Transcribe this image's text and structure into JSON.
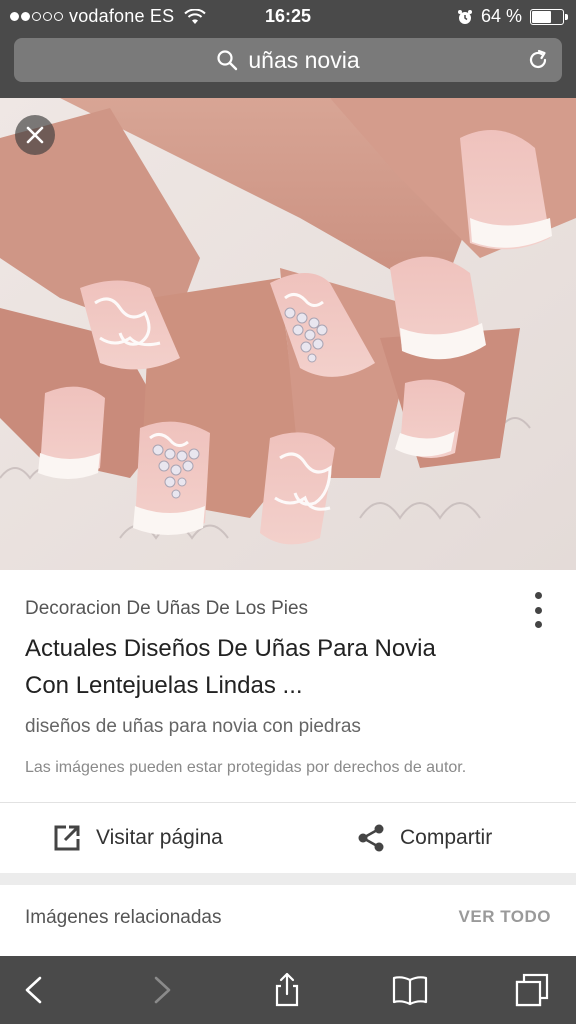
{
  "status_bar": {
    "carrier": "vodafone ES",
    "time": "16:25",
    "battery": "64 %",
    "battery_level": 0.64
  },
  "search": {
    "query": "uñas novia"
  },
  "result": {
    "source": "Decoracion De Uñas De Los Pies",
    "title_line1": "Actuales Diseños De Uñas Para Novia",
    "title_line2": "Con Lentejuelas Lindas ...",
    "description": "diseños de uñas para novia con piedras",
    "copyright": "Las imágenes pueden estar protegidas por derechos de autor."
  },
  "actions": {
    "visit_label": "Visitar página",
    "share_label": "Compartir"
  },
  "related": {
    "title": "Imágenes relacionadas",
    "view_all": "VER TODO"
  },
  "colors": {
    "chrome": "#4a4a4a",
    "url_bar": "#7a7a7a"
  }
}
